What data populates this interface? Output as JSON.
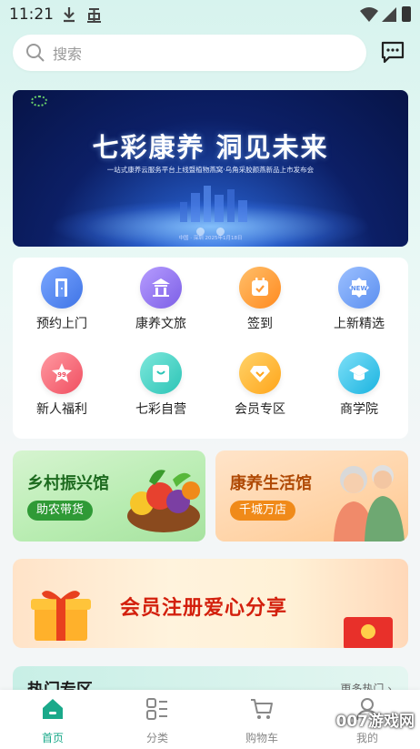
{
  "status_bar": {
    "time": "11:21"
  },
  "search": {
    "placeholder": "搜索"
  },
  "banner": {
    "title": "七彩康养  洞见未来",
    "subtitle": "一站式康养云服务平台上线暨植物燕窝·乌角采胶颜燕新品上市发布会",
    "footer": "中国 · 深圳    2025年1月18日",
    "dots": 2
  },
  "grid": {
    "items": [
      {
        "label": "预约上门",
        "icon": "door-icon",
        "color": "#5a8cf0"
      },
      {
        "label": "康养文旅",
        "icon": "pavilion-icon",
        "color": "#9a7ff0"
      },
      {
        "label": "签到",
        "icon": "calendar-check-icon",
        "color": "#ff9f3a"
      },
      {
        "label": "上新精选",
        "icon": "new-badge-icon",
        "color": "#6aa0f5"
      },
      {
        "label": "新人福利",
        "icon": "star-99-icon",
        "color": "#f36a76"
      },
      {
        "label": "七彩自营",
        "icon": "shopping-bag-icon",
        "color": "#3fd1c5"
      },
      {
        "label": "会员专区",
        "icon": "diamond-icon",
        "color": "#ffb32b"
      },
      {
        "label": "商学院",
        "icon": "graduation-cap-icon",
        "color": "#36c3e8"
      }
    ]
  },
  "promos": {
    "left": {
      "title": "乡村振兴馆",
      "tag": "助农带货"
    },
    "right": {
      "title": "康养生活馆",
      "tag": "千城万店"
    }
  },
  "member_banner": {
    "title": "会员注册爱心分享"
  },
  "section": {
    "title": "热门专区",
    "more": "更多热门 ›"
  },
  "bottom_nav": {
    "items": [
      {
        "label": "首页",
        "icon": "home-icon",
        "active": true
      },
      {
        "label": "分类",
        "icon": "category-icon",
        "active": false
      },
      {
        "label": "购物车",
        "icon": "cart-icon",
        "active": false
      },
      {
        "label": "我的",
        "icon": "user-icon",
        "active": false
      }
    ],
    "active_color": "#1aa98a"
  },
  "watermark": "007游戏网"
}
